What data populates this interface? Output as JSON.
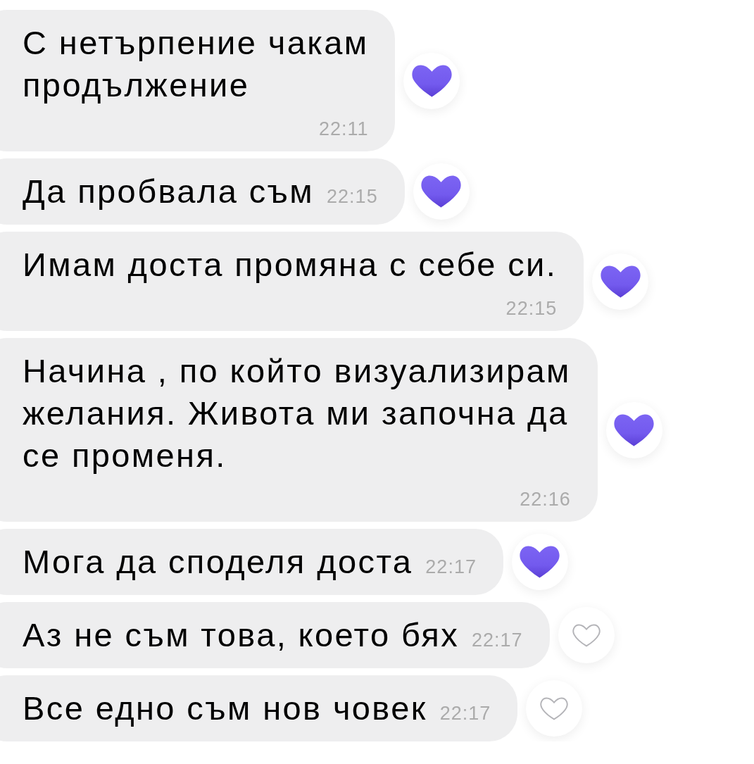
{
  "messages": [
    {
      "text": "С нетърпение чакам\nпродължение",
      "time": "22:11",
      "kind": "stacked",
      "liked": true
    },
    {
      "text": "Да пробвала съм",
      "time": "22:15",
      "kind": "inline",
      "liked": true
    },
    {
      "text": "Имам доста промяна с себе си.",
      "time": "22:15",
      "kind": "stacked",
      "liked": true
    },
    {
      "text": "Начина , по който визуализирам\nжелания. Живота ми започна да\nсе променя.",
      "time": "22:16",
      "kind": "stacked",
      "liked": true
    },
    {
      "text": "Мога да споделя доста",
      "time": "22:17",
      "kind": "inline",
      "liked": true
    },
    {
      "text": "Аз не съм това, което бях",
      "time": "22:17",
      "kind": "inline",
      "liked": false
    },
    {
      "text": "Все едно съм нов човек",
      "time": "22:17",
      "kind": "inline",
      "liked": false
    }
  ]
}
